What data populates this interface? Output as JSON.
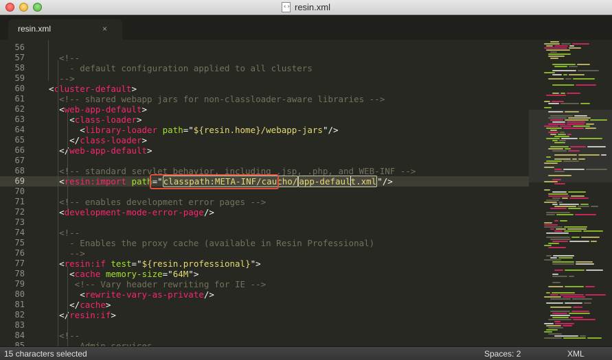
{
  "window": {
    "title": "resin.xml"
  },
  "tab": {
    "label": "resin.xml",
    "close_glyph": "×"
  },
  "status": {
    "selection": "15 characters selected",
    "spaces": "Spaces: 2",
    "syntax": "XML"
  },
  "lines": [
    {
      "num": "56",
      "tokens": []
    },
    {
      "num": "57",
      "tokens": [
        {
          "c": "tk-c",
          "t": "    <!--"
        }
      ]
    },
    {
      "num": "58",
      "tokens": [
        {
          "c": "tk-c",
          "t": "      - default configuration applied to all clusters"
        }
      ]
    },
    {
      "num": "59",
      "tokens": [
        {
          "c": "tk-c",
          "t": "    -->"
        }
      ]
    },
    {
      "num": "60",
      "tokens": [
        {
          "c": "tk-p",
          "t": "  <"
        },
        {
          "c": "tk-t",
          "t": "cluster-default"
        },
        {
          "c": "tk-p",
          "t": ">"
        }
      ]
    },
    {
      "num": "61",
      "tokens": [
        {
          "c": "tk-c",
          "t": "    <!-- shared webapp jars for non-classloader-aware libraries -->"
        }
      ]
    },
    {
      "num": "62",
      "tokens": [
        {
          "c": "tk-p",
          "t": "    <"
        },
        {
          "c": "tk-t",
          "t": "web-app-default"
        },
        {
          "c": "tk-p",
          "t": ">"
        }
      ]
    },
    {
      "num": "63",
      "tokens": [
        {
          "c": "tk-p",
          "t": "      <"
        },
        {
          "c": "tk-t",
          "t": "class-loader"
        },
        {
          "c": "tk-p",
          "t": ">"
        }
      ]
    },
    {
      "num": "64",
      "tokens": [
        {
          "c": "tk-p",
          "t": "        <"
        },
        {
          "c": "tk-t",
          "t": "library-loader"
        },
        {
          "c": "tk-p",
          "t": " "
        },
        {
          "c": "tk-a",
          "t": "path"
        },
        {
          "c": "tk-p",
          "t": "=\""
        },
        {
          "c": "tk-s",
          "t": "${resin.home}/webapp-jars"
        },
        {
          "c": "tk-p",
          "t": "\"/>"
        }
      ]
    },
    {
      "num": "65",
      "tokens": [
        {
          "c": "tk-p",
          "t": "      </"
        },
        {
          "c": "tk-t",
          "t": "class-loader"
        },
        {
          "c": "tk-p",
          "t": ">"
        }
      ]
    },
    {
      "num": "66",
      "tokens": [
        {
          "c": "tk-p",
          "t": "    </"
        },
        {
          "c": "tk-t",
          "t": "web-app-default"
        },
        {
          "c": "tk-p",
          "t": ">"
        }
      ]
    },
    {
      "num": "67",
      "tokens": []
    },
    {
      "num": "68",
      "tokens": [
        {
          "c": "tk-c",
          "t": "    <!-- standard servlet behavior, including .jsp, .php, and WEB-INF -->"
        }
      ]
    },
    {
      "num": "69",
      "current": true,
      "tokens": [
        {
          "c": "tk-p",
          "t": "    <"
        },
        {
          "c": "tk-t",
          "t": "resin:import"
        },
        {
          "c": "tk-p",
          "t": " "
        },
        {
          "c": "tk-a",
          "t": "path"
        },
        {
          "c": "tk-p",
          "t": "=\""
        },
        {
          "c": "tk-s sel sel-box",
          "t": "classpath:META-INF/caucho/"
        },
        {
          "c": "tk-s sel sel-box",
          "t": "app-default.xml"
        },
        {
          "c": "tk-p",
          "t": "\"/>"
        }
      ]
    },
    {
      "num": "70",
      "tokens": []
    },
    {
      "num": "71",
      "tokens": [
        {
          "c": "tk-c",
          "t": "    <!-- enables development error pages -->"
        }
      ]
    },
    {
      "num": "72",
      "tokens": [
        {
          "c": "tk-p",
          "t": "    <"
        },
        {
          "c": "tk-t",
          "t": "development-mode-error-page"
        },
        {
          "c": "tk-p",
          "t": "/>"
        }
      ]
    },
    {
      "num": "73",
      "tokens": []
    },
    {
      "num": "74",
      "tokens": [
        {
          "c": "tk-c",
          "t": "    <!--"
        }
      ]
    },
    {
      "num": "75",
      "tokens": [
        {
          "c": "tk-c",
          "t": "      - Enables the proxy cache (available in Resin Professional)"
        }
      ]
    },
    {
      "num": "76",
      "tokens": [
        {
          "c": "tk-c",
          "t": "      -->"
        }
      ]
    },
    {
      "num": "77",
      "tokens": [
        {
          "c": "tk-p",
          "t": "    <"
        },
        {
          "c": "tk-t",
          "t": "resin:if"
        },
        {
          "c": "tk-p",
          "t": " "
        },
        {
          "c": "tk-a",
          "t": "test"
        },
        {
          "c": "tk-p",
          "t": "=\""
        },
        {
          "c": "tk-s",
          "t": "${resin.professional}"
        },
        {
          "c": "tk-p",
          "t": "\">"
        }
      ]
    },
    {
      "num": "78",
      "tokens": [
        {
          "c": "tk-p",
          "t": "      <"
        },
        {
          "c": "tk-t",
          "t": "cache"
        },
        {
          "c": "tk-p",
          "t": " "
        },
        {
          "c": "tk-a",
          "t": "memory-size"
        },
        {
          "c": "tk-p",
          "t": "=\""
        },
        {
          "c": "tk-s",
          "t": "64M"
        },
        {
          "c": "tk-p",
          "t": "\">"
        }
      ]
    },
    {
      "num": "79",
      "tokens": [
        {
          "c": "tk-c",
          "t": "       <!-- Vary header rewriting for IE -->"
        }
      ]
    },
    {
      "num": "80",
      "tokens": [
        {
          "c": "tk-p",
          "t": "        <"
        },
        {
          "c": "tk-t",
          "t": "rewrite-vary-as-private"
        },
        {
          "c": "tk-p",
          "t": "/>"
        }
      ]
    },
    {
      "num": "81",
      "tokens": [
        {
          "c": "tk-p",
          "t": "      </"
        },
        {
          "c": "tk-t",
          "t": "cache"
        },
        {
          "c": "tk-p",
          "t": ">"
        }
      ]
    },
    {
      "num": "82",
      "tokens": [
        {
          "c": "tk-p",
          "t": "    </"
        },
        {
          "c": "tk-t",
          "t": "resin:if"
        },
        {
          "c": "tk-p",
          "t": ">"
        }
      ]
    },
    {
      "num": "83",
      "tokens": []
    },
    {
      "num": "84",
      "tokens": [
        {
          "c": "tk-c",
          "t": "    <!--"
        }
      ]
    },
    {
      "num": "85",
      "tokens": [
        {
          "c": "tk-c",
          "t": "      - Admin services"
        }
      ]
    }
  ]
}
